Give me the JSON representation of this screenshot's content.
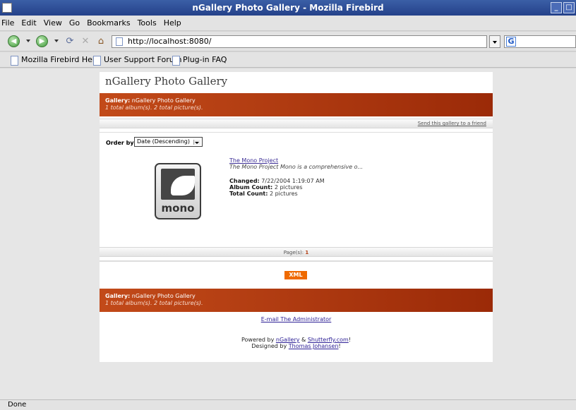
{
  "window": {
    "title": "nGallery Photo Gallery - Mozilla Firebird"
  },
  "menu": [
    "File",
    "Edit",
    "View",
    "Go",
    "Bookmarks",
    "Tools",
    "Help"
  ],
  "address": {
    "url": "http://localhost:8080/",
    "search_icon": "G"
  },
  "bookmarks": [
    "Mozilla Firebird Help",
    "User Support Forum",
    "Plug-in FAQ"
  ],
  "page": {
    "site_title": "nGallery Photo Gallery",
    "header": {
      "gallery_label": "Gallery:",
      "gallery_name": "nGallery Photo Gallery",
      "summary": "1 total album(s). 2 total picture(s)."
    },
    "send_link": "Send this gallery to a friend",
    "order": {
      "label": "Order by:",
      "selected": "Date (Descending)"
    },
    "album": {
      "logo_text": "mono",
      "title": "The Mono Project",
      "description": "The Mono Project Mono is a comprehensive o...",
      "changed_label": "Changed:",
      "changed_value": "7/22/2004 1:19:07 AM",
      "album_count_label": "Album Count:",
      "album_count_value": "2 pictures",
      "total_count_label": "Total Count:",
      "total_count_value": "2 pictures"
    },
    "pages": {
      "label": "Page(s):",
      "current": "1"
    },
    "xml_button": "XML",
    "footer": {
      "gallery_label": "Gallery:",
      "gallery_name": "nGallery Photo Gallery",
      "summary": "1 total album(s). 2 total picture(s).",
      "email_link": "E-mail The Administrator",
      "powered_prefix": "Powered by",
      "powered_link1": "nGallery",
      "powered_amp": "&",
      "powered_link2": "Shutterfly.com",
      "powered_suffix": "!",
      "designed_prefix": "Designed by",
      "designed_link": "Thomas Johansen",
      "designed_suffix": "!"
    }
  },
  "status": {
    "text": "Done"
  }
}
